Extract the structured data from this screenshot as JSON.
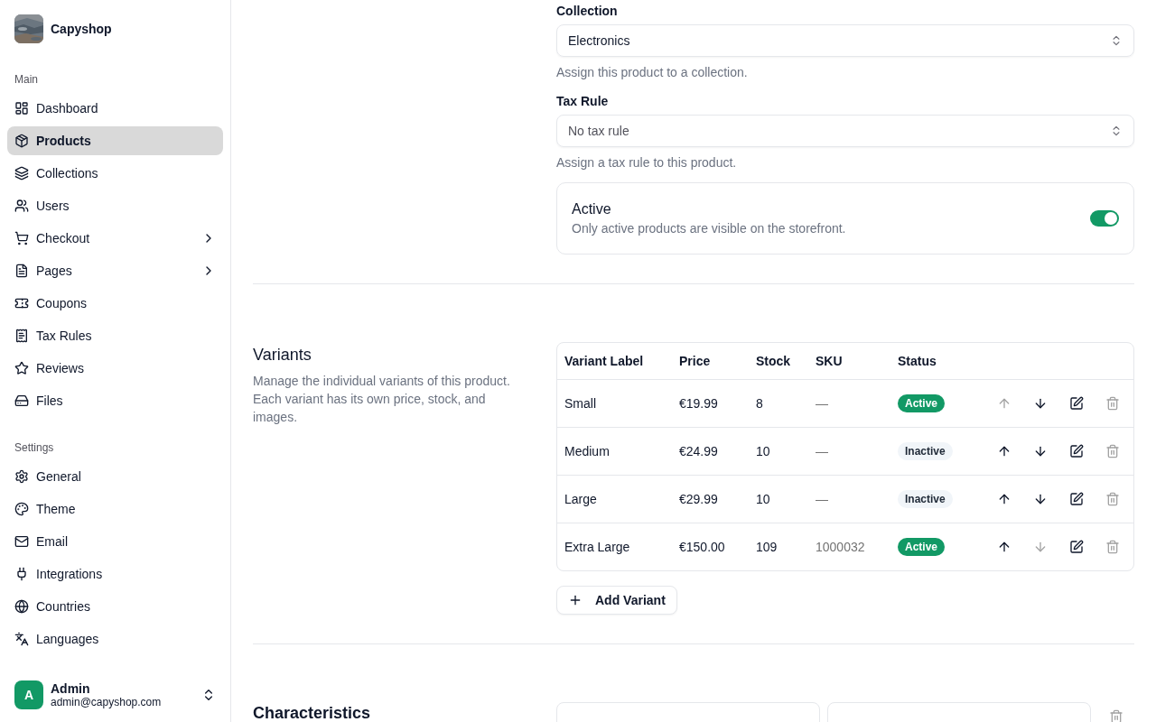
{
  "sidebar": {
    "brand": {
      "name": "Capyshop"
    },
    "groups": [
      {
        "title": "Main",
        "items": [
          {
            "label": "Dashboard",
            "selected": false,
            "submenu": false
          },
          {
            "label": "Products",
            "selected": true,
            "submenu": false
          },
          {
            "label": "Collections",
            "selected": false,
            "submenu": false
          },
          {
            "label": "Users",
            "selected": false,
            "submenu": false
          },
          {
            "label": "Checkout",
            "selected": false,
            "submenu": true
          },
          {
            "label": "Pages",
            "selected": false,
            "submenu": true
          },
          {
            "label": "Coupons",
            "selected": false,
            "submenu": false
          },
          {
            "label": "Tax Rules",
            "selected": false,
            "submenu": false
          },
          {
            "label": "Reviews",
            "selected": false,
            "submenu": false
          },
          {
            "label": "Files",
            "selected": false,
            "submenu": false
          }
        ]
      },
      {
        "title": "Settings",
        "items": [
          {
            "label": "General",
            "selected": false,
            "submenu": false
          },
          {
            "label": "Theme",
            "selected": false,
            "submenu": false
          },
          {
            "label": "Email",
            "selected": false,
            "submenu": false
          },
          {
            "label": "Integrations",
            "selected": false,
            "submenu": false
          },
          {
            "label": "Countries",
            "selected": false,
            "submenu": false
          },
          {
            "label": "Languages",
            "selected": false,
            "submenu": false
          }
        ]
      }
    ],
    "user": {
      "initial": "A",
      "name": "Admin",
      "email": "admin@capyshop.com"
    }
  },
  "organization": {
    "fields": [
      {
        "label": "Collection",
        "value": "Electronics",
        "placeholder_shown": false,
        "help": "Assign this product to a collection."
      },
      {
        "label": "Tax Rule",
        "value": "No tax rule",
        "placeholder_shown": true,
        "help": "Assign a tax rule to this product."
      }
    ],
    "active_card": {
      "title": "Active",
      "description": "Only active products are visible on the storefront.",
      "on": true
    }
  },
  "variants": {
    "title": "Variants",
    "description": "Manage the individual variants of this product. Each variant has its own price, stock, and images.",
    "table": {
      "columns": [
        "Variant Label",
        "Price",
        "Stock",
        "SKU",
        "Status"
      ],
      "rows": [
        {
          "label": "Small",
          "price": "€19.99",
          "stock": "8",
          "sku": "—",
          "status": {
            "kind": "active",
            "text": "Active"
          },
          "up_disabled": true,
          "down_disabled": false
        },
        {
          "label": "Medium",
          "price": "€24.99",
          "stock": "10",
          "sku": "—",
          "status": {
            "kind": "inactive",
            "text": "Inactive"
          },
          "up_disabled": false,
          "down_disabled": false
        },
        {
          "label": "Large",
          "price": "€29.99",
          "stock": "10",
          "sku": "—",
          "status": {
            "kind": "inactive",
            "text": "Inactive"
          },
          "up_disabled": false,
          "down_disabled": false
        },
        {
          "label": "Extra Large",
          "price": "€150.00",
          "stock": "109",
          "sku": "1000032",
          "status": {
            "kind": "active",
            "text": "Active"
          },
          "up_disabled": false,
          "down_disabled": true
        }
      ]
    },
    "add_button": "Add Variant"
  },
  "characteristics": {
    "title": "Characteristics"
  }
}
